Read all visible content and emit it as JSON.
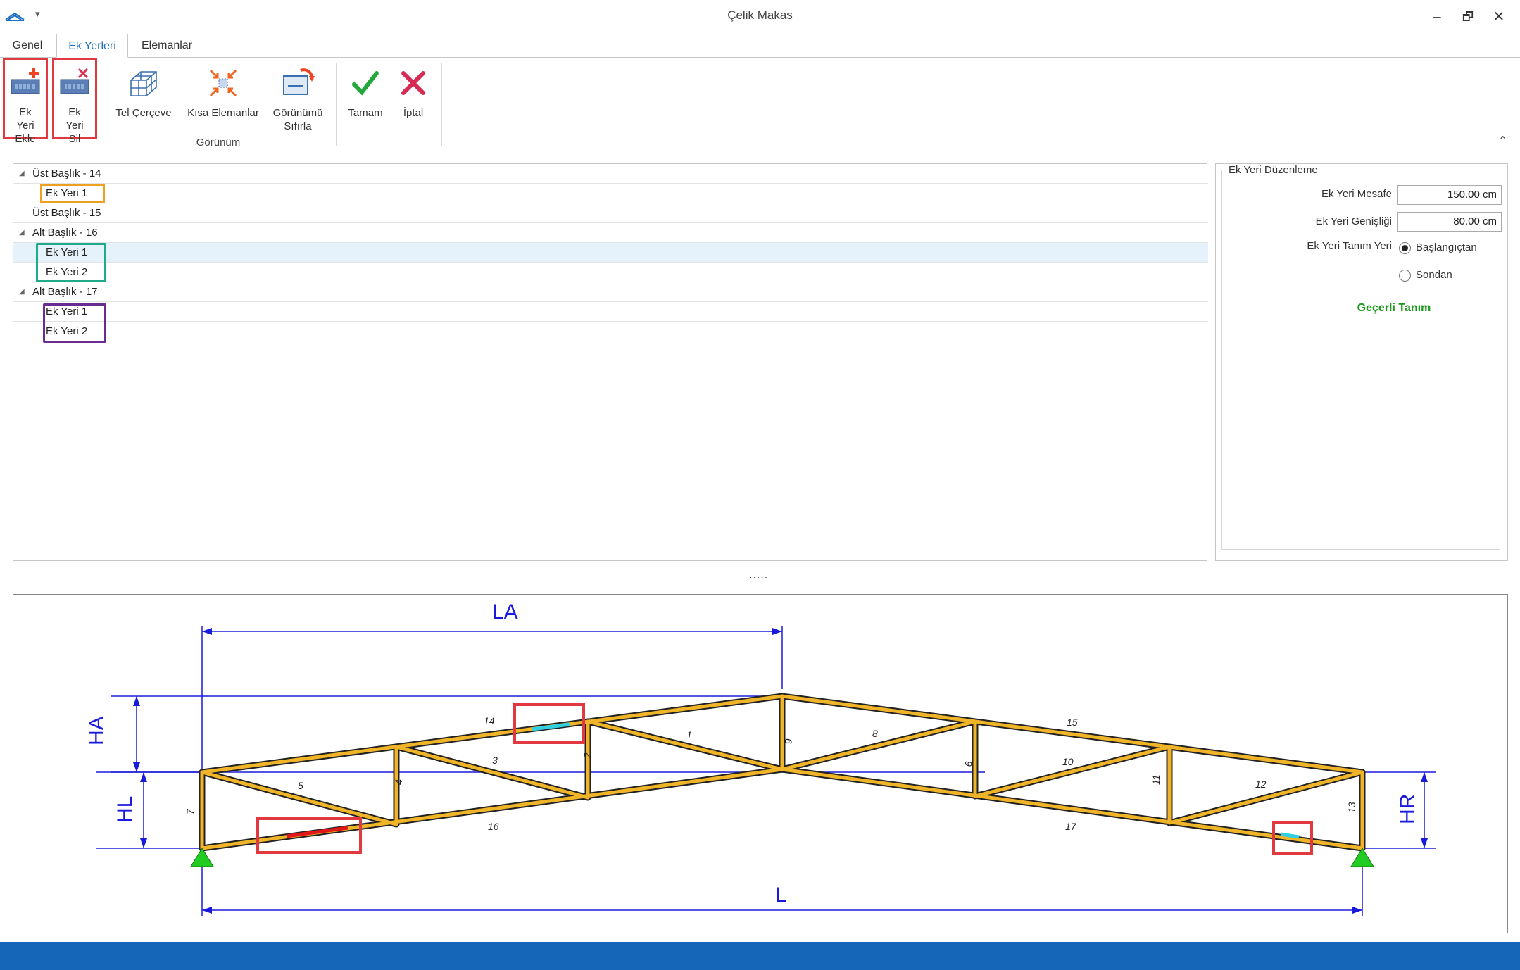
{
  "window": {
    "title": "Çelik Makas",
    "controls": [
      "–",
      "🗗",
      "✕"
    ]
  },
  "tabs": [
    {
      "label": "Genel"
    },
    {
      "label": "Ek Yerleri",
      "active": true
    },
    {
      "label": "Elemanlar"
    }
  ],
  "ribbon": {
    "add_joint": "Ek Yeri Ekle",
    "delete_joint": "Ek Yeri Sil",
    "wireframe": "Tel Çerçeve",
    "short_elements": "Kısa Elemanlar",
    "reset_view": "Görünümü Sıfırla",
    "view_group": "Görünüm",
    "ok": "Tamam",
    "cancel": "İptal",
    "collapse": "⌃"
  },
  "tree": [
    {
      "label": "Üst Başlık - 14",
      "level": 0,
      "expanded": true
    },
    {
      "label": "Ek Yeri 1",
      "level": 1
    },
    {
      "label": "Üst Başlık - 15",
      "level": 0
    },
    {
      "label": "Alt Başlık - 16",
      "level": 0,
      "expanded": true
    },
    {
      "label": "Ek Yeri 1",
      "level": 1,
      "selected": true
    },
    {
      "label": "Ek Yeri 2",
      "level": 1
    },
    {
      "label": "Alt Başlık - 17",
      "level": 0,
      "expanded": true
    },
    {
      "label": "Ek Yeri 1",
      "level": 1
    },
    {
      "label": "Ek Yeri 2",
      "level": 1
    }
  ],
  "panel": {
    "title": "Ek Yeri Düzenleme",
    "distance_label": "Ek Yeri Mesafe",
    "distance_value": "150.00 cm",
    "width_label": "Ek Yeri Genişliği",
    "width_value": "80.00 cm",
    "origin_label": "Ek Yeri Tanım Yeri",
    "origin_start": "Başlangıçtan",
    "origin_end": "Sondan",
    "origin_selected": "Başlangıçtan",
    "status": "Geçerli Tanım"
  },
  "splitter": ".....",
  "drawing": {
    "dims": {
      "LA": "LA",
      "HA": "HA",
      "HL": "HL",
      "HR": "HR",
      "L": "L"
    },
    "member_labels": [
      "1",
      "2",
      "3",
      "4",
      "5",
      "6",
      "7",
      "8",
      "9",
      "10",
      "11",
      "12",
      "13",
      "14",
      "15",
      "16",
      "17"
    ]
  },
  "colors": {
    "accent": "#1e6fbf",
    "member": "#f0b428",
    "dimension": "#1a1adc",
    "highlight_red": "#e0393f",
    "highlight_orange": "#f0a020",
    "highlight_teal": "#1faa8a",
    "highlight_purple": "#6a2c91",
    "valid": "#1a9a1a",
    "status_bar": "#1565b8"
  }
}
